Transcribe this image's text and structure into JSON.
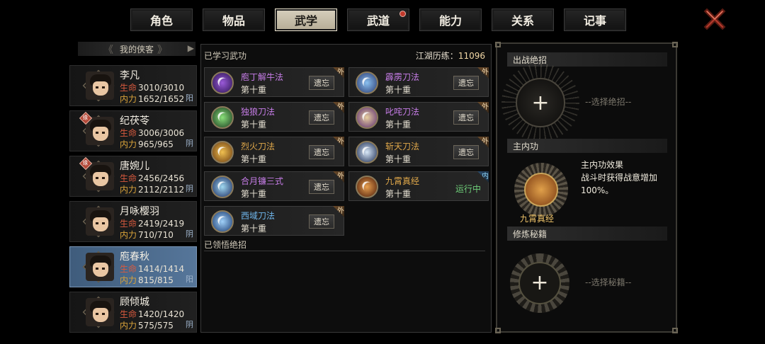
{
  "tabs": [
    {
      "label": "角色",
      "active": false,
      "notify": false
    },
    {
      "label": "物品",
      "active": false,
      "notify": false
    },
    {
      "label": "武学",
      "active": true,
      "notify": false
    },
    {
      "label": "武道",
      "active": false,
      "notify": true
    },
    {
      "label": "能力",
      "active": false,
      "notify": false
    },
    {
      "label": "关系",
      "active": false,
      "notify": false
    },
    {
      "label": "记事",
      "active": false,
      "notify": false
    }
  ],
  "roster": {
    "title": "我的侠客",
    "heroes": [
      {
        "name": "李凡",
        "hp_label": "生命",
        "hp": "3010/3010",
        "mp_label": "内力",
        "mp": "1652/1652",
        "yin": "阳",
        "badge": "",
        "selected": false
      },
      {
        "name": "纪茯苓",
        "hp_label": "生命",
        "hp": "3006/3006",
        "mp_label": "内力",
        "mp": "965/965",
        "yin": "阴",
        "badge": "缘",
        "selected": false
      },
      {
        "name": "唐婉儿",
        "hp_label": "生命",
        "hp": "2456/2456",
        "mp_label": "内力",
        "mp": "2112/2112",
        "yin": "阴",
        "badge": "缘",
        "selected": false
      },
      {
        "name": "月咏樱羽",
        "hp_label": "生命",
        "hp": "2419/2419",
        "mp_label": "内力",
        "mp": "710/710",
        "yin": "阴",
        "badge": "",
        "selected": false
      },
      {
        "name": "庖春秋",
        "hp_label": "生命",
        "hp": "1414/1414",
        "mp_label": "内力",
        "mp": "815/815",
        "yin": "阳",
        "badge": "",
        "selected": true
      },
      {
        "name": "顾倾城",
        "hp_label": "生命",
        "hp": "1420/1420",
        "mp_label": "内力",
        "mp": "575/575",
        "yin": "阴",
        "badge": "",
        "selected": false
      }
    ]
  },
  "martial": {
    "learned_header": "已学习武功",
    "exp_label": "江湖历练：",
    "exp_value": "11096",
    "forget_label": "遗忘",
    "skills": [
      {
        "name": "庖丁解牛法",
        "level": "第十重",
        "tag": "外",
        "color": "#c77de8",
        "icon": "purple-slash-icon",
        "status": "forget"
      },
      {
        "name": "霹雳刀法",
        "level": "第十重",
        "tag": "外",
        "color": "#c77de8",
        "icon": "lightning-blade-icon",
        "status": "forget"
      },
      {
        "name": "独狼刀法",
        "level": "第十重",
        "tag": "外",
        "color": "#c77de8",
        "icon": "wolf-claw-icon",
        "status": "forget"
      },
      {
        "name": "叱咤刀法",
        "level": "第十重",
        "tag": "外",
        "color": "#c77de8",
        "icon": "roar-blade-icon",
        "status": "forget"
      },
      {
        "name": "烈火刀法",
        "level": "第十重",
        "tag": "外",
        "color": "#e0a84a",
        "icon": "fire-blade-icon",
        "status": "forget"
      },
      {
        "name": "斩天刀法",
        "level": "第十重",
        "tag": "外",
        "color": "#e0a84a",
        "icon": "sky-slash-icon",
        "status": "forget"
      },
      {
        "name": "合月镰三式",
        "level": "第十重",
        "tag": "外",
        "color": "#c77de8",
        "icon": "moon-sickle-icon",
        "status": "forget"
      },
      {
        "name": "九霄真经",
        "level": "第十重",
        "tag": "内",
        "color": "#e0a84a",
        "icon": "nine-heavens-icon",
        "status": "running",
        "status_label": "运行中"
      },
      {
        "name": "西域刀法",
        "level": "第十重",
        "tag": "外",
        "color": "#6fb6ec",
        "icon": "western-blade-icon",
        "status": "forget"
      }
    ],
    "comprehended_header": "已领悟绝招"
  },
  "right_panel": {
    "ultimate_header": "出战绝招",
    "ultimate_placeholder": "--选择绝招--",
    "core_header": "主内功",
    "core_name": "九霄真经",
    "core_effect_title": "主内功效果",
    "core_effect_desc": "战斗时获得战意增加100%。",
    "manual_header": "修炼秘籍",
    "manual_placeholder": "--选择秘籍--"
  },
  "colors": {
    "accent_gold": "#f0c46a",
    "hp_red": "#d85a3e",
    "mp_orange": "#d8a23a",
    "running_green": "#6fd07a",
    "selected_blue": "#56769a"
  }
}
